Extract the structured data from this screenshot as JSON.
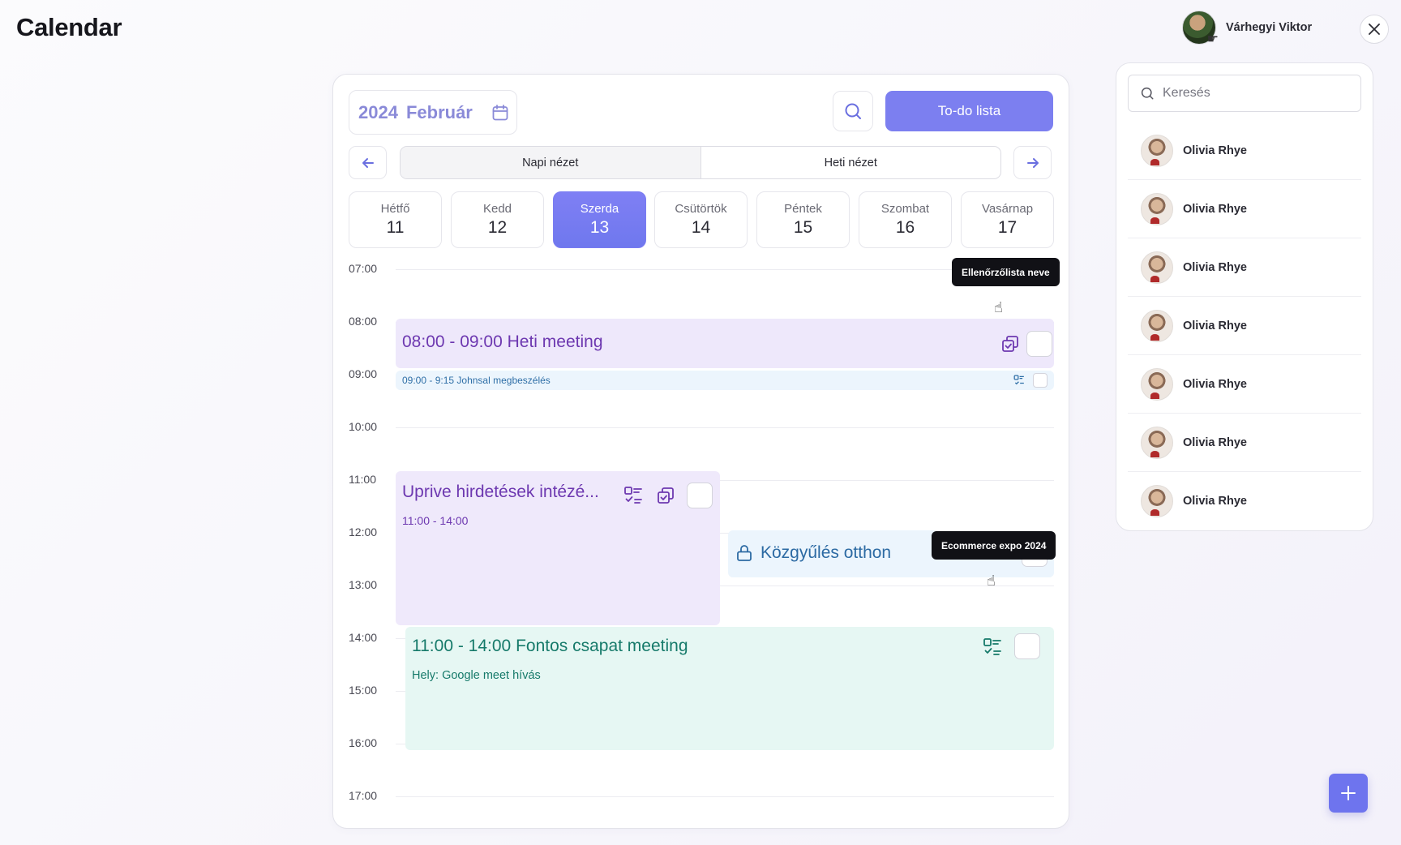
{
  "app": {
    "title": "Calendar"
  },
  "user": {
    "name": "Várhegyi Viktor"
  },
  "calendar": {
    "year": "2024",
    "month": "Február",
    "todo_label": "To-do lista",
    "views": {
      "daily": "Napi nézet",
      "weekly": "Heti nézet"
    },
    "days": [
      {
        "name": "Hétfő",
        "num": "11"
      },
      {
        "name": "Kedd",
        "num": "12"
      },
      {
        "name": "Szerda",
        "num": "13"
      },
      {
        "name": "Csütörtök",
        "num": "14"
      },
      {
        "name": "Péntek",
        "num": "15"
      },
      {
        "name": "Szombat",
        "num": "16"
      },
      {
        "name": "Vasárnap",
        "num": "17"
      }
    ],
    "selected_day": "13",
    "hours": [
      "07:00",
      "08:00",
      "09:00",
      "10:00",
      "11:00",
      "12:00",
      "13:00",
      "14:00",
      "15:00",
      "16:00",
      "17:00"
    ],
    "events": {
      "heti": {
        "time": "08:00 - 09:00",
        "title": "Heti meeting"
      },
      "johnsal": {
        "time": "09:00 - 9:15",
        "title": "Johnsal megbeszélés"
      },
      "uprive": {
        "title": "Uprive hirdetések intézé...",
        "time": "11:00 - 14:00"
      },
      "kozgy": {
        "title": "Közgyűlés otthon"
      },
      "fontos": {
        "time": "11:00 - 14:00",
        "title": "Fontos csapat meeting",
        "location": "Hely: Google meet hívás"
      }
    },
    "tooltips": {
      "checklist": "Ellenőrzőlista neve",
      "expo": "Ecommerce expo 2024"
    }
  },
  "side": {
    "search_placeholder": "Keresés",
    "people": [
      "Olivia Rhye",
      "Olivia Rhye",
      "Olivia Rhye",
      "Olivia Rhye",
      "Olivia Rhye",
      "Olivia Rhye",
      "Olivia Rhye"
    ]
  },
  "colors": {
    "accent": "#7c7ff0",
    "event_purple": "#eee8fb",
    "event_blue": "#ecf5fd",
    "event_green": "#e6f7f3"
  },
  "icons": [
    "calendar-icon",
    "search-icon",
    "arrow-left-icon",
    "arrow-right-icon",
    "close-icon",
    "copy-icon",
    "checklist-icon",
    "lock-icon",
    "plus-icon"
  ]
}
